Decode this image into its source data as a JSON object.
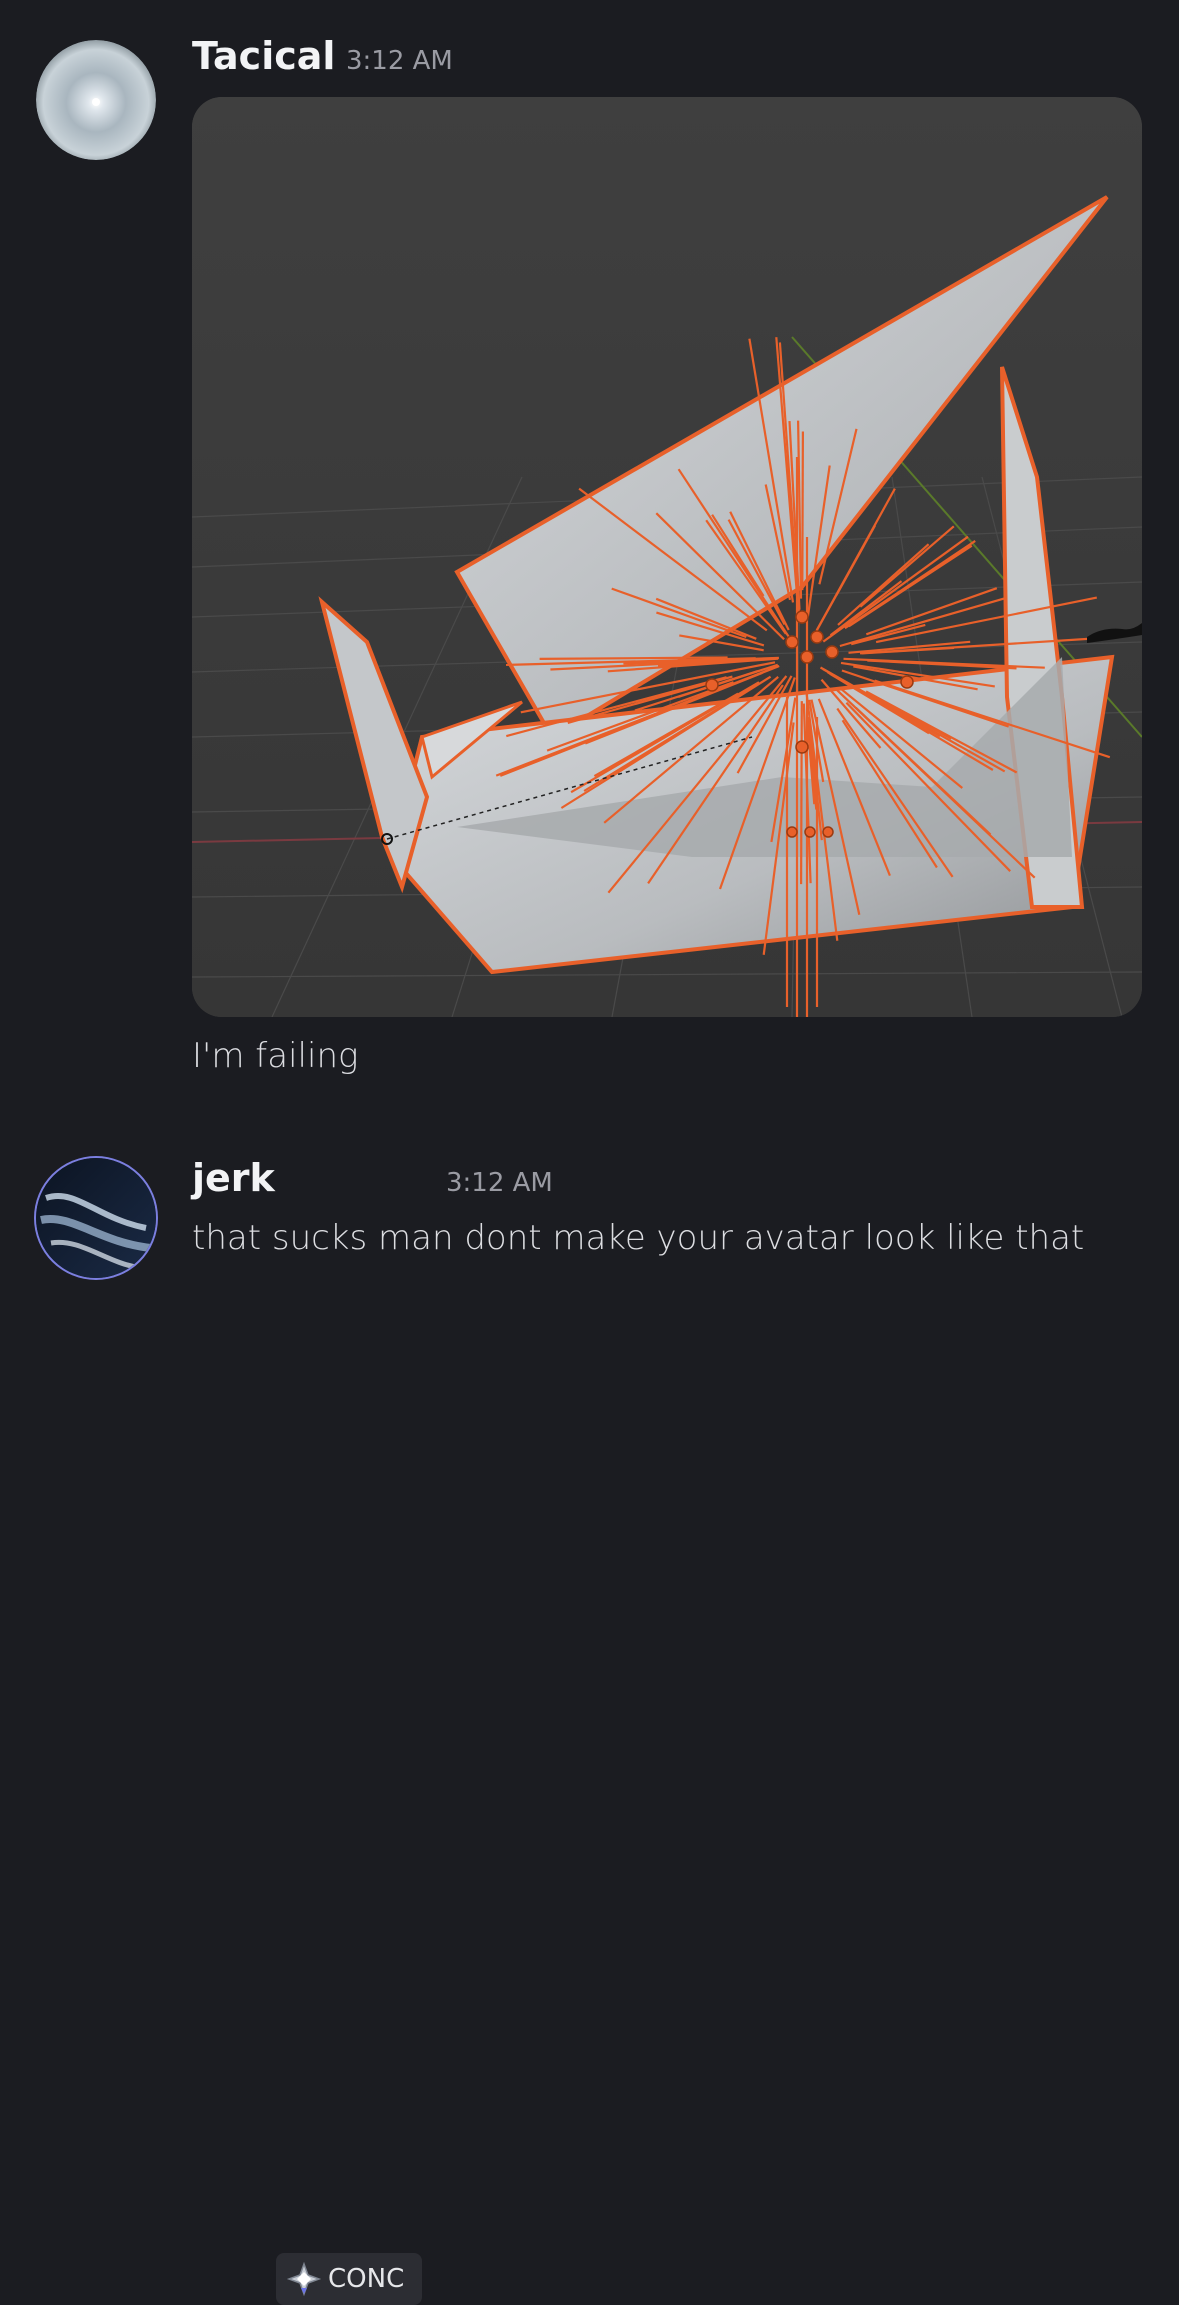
{
  "messages": [
    {
      "username": "Tacical",
      "timestamp": "3:12 AM",
      "avatar_icon": "orb-avatar",
      "attachment_icon": "3d-viewport-screenshot",
      "content": "I'm failing"
    },
    {
      "username": "jerk",
      "timestamp": "3:12 AM",
      "avatar_icon": "dark-swirl-avatar",
      "tag": {
        "icon": "diamond-badge-icon",
        "label": "CONC"
      },
      "content": "that sucks man dont make your avatar look like that"
    }
  ],
  "colors": {
    "background": "#1b1c21",
    "username": "#f2f3f5",
    "timestamp": "#9a9ba3",
    "accent_orange": "#e8602a",
    "tag_background": "#2c2d33"
  }
}
